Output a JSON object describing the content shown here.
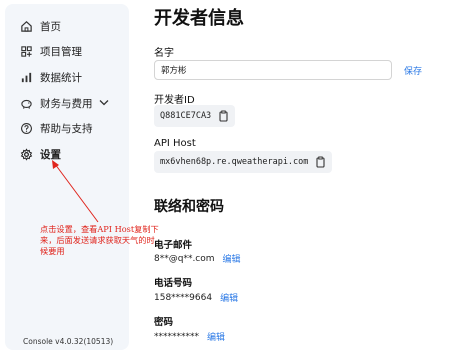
{
  "sidebar": {
    "items": [
      {
        "label": "首页",
        "icon": "home-icon"
      },
      {
        "label": "项目管理",
        "icon": "grid-icon"
      },
      {
        "label": "数据统计",
        "icon": "bar-chart-icon"
      },
      {
        "label": "财务与费用",
        "icon": "piggy-bank-icon"
      },
      {
        "label": "帮助与支持",
        "icon": "help-circle-icon"
      },
      {
        "label": "设置",
        "icon": "gear-icon",
        "active": true
      }
    ],
    "version": "Console v4.0.32(10513)"
  },
  "main": {
    "title": "开发者信息",
    "name": {
      "label": "名字",
      "value": "郭方彬",
      "save": "保存"
    },
    "developer_id": {
      "label": "开发者ID",
      "value": "Q881CE7CA3"
    },
    "api_host": {
      "label": "API Host",
      "value": "mx6vhen68p.re.qweatherapi.com"
    }
  },
  "contact": {
    "title": "联络和密码",
    "email": {
      "label": "电子邮件",
      "value": "8**@q**.com",
      "edit": "编辑"
    },
    "phone": {
      "label": "电话号码",
      "value": "158****9664",
      "edit": "编辑"
    },
    "password": {
      "label": "密码",
      "value": "**********",
      "edit": "编辑"
    }
  },
  "annotation": {
    "text": "点击设置，查看API Host复制下来，后面发送请求获取天气的时候要用",
    "color": "#e0241c"
  },
  "colors": {
    "accent": "#2b79e6",
    "sidebar_bg": "#f3f6fa"
  }
}
